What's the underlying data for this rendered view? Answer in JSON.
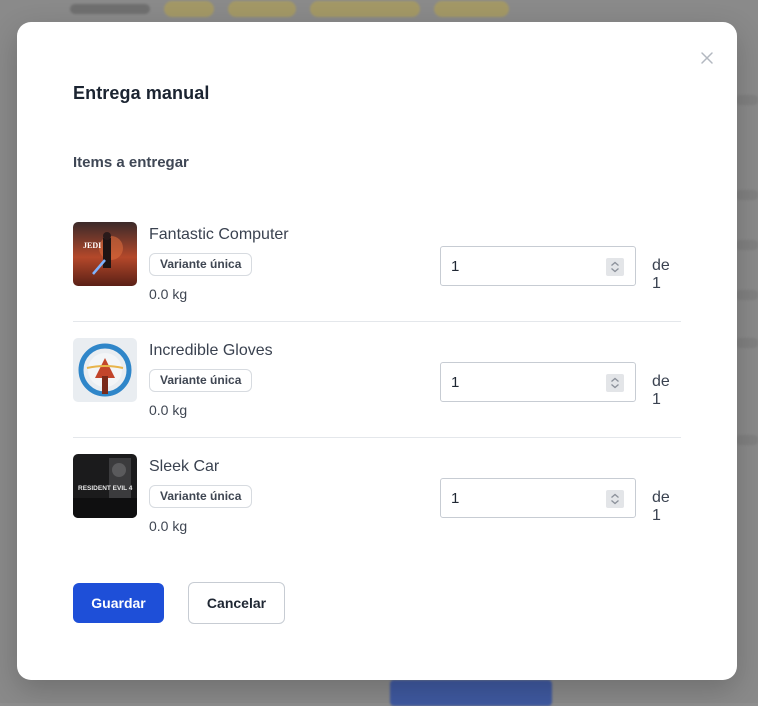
{
  "modal": {
    "title": "Entrega manual",
    "section_title": "Items a entregar",
    "close_icon": "close-icon"
  },
  "items": [
    {
      "name": "Fantastic Computer",
      "variant": "Variante única",
      "weight": "0.0 kg",
      "quantity": "1",
      "of_total": "de 1",
      "thumbnail_text": "JEDI",
      "thumbnail_icon": "game-cover-jedi"
    },
    {
      "name": "Incredible Gloves",
      "variant": "Variante única",
      "weight": "0.0 kg",
      "quantity": "1",
      "of_total": "de 1",
      "thumbnail_icon": "game-cover-mortal-kombat"
    },
    {
      "name": "Sleek Car",
      "variant": "Variante única",
      "weight": "0.0 kg",
      "quantity": "1",
      "of_total": "de 1",
      "thumbnail_text": "RESIDENT EVIL 4",
      "thumbnail_icon": "game-cover-resident-evil"
    }
  ],
  "actions": {
    "save_label": "Guardar",
    "cancel_label": "Cancelar"
  },
  "colors": {
    "primary": "#1e4fd8",
    "text": "#3a4250",
    "border": "#c7ccd3"
  }
}
